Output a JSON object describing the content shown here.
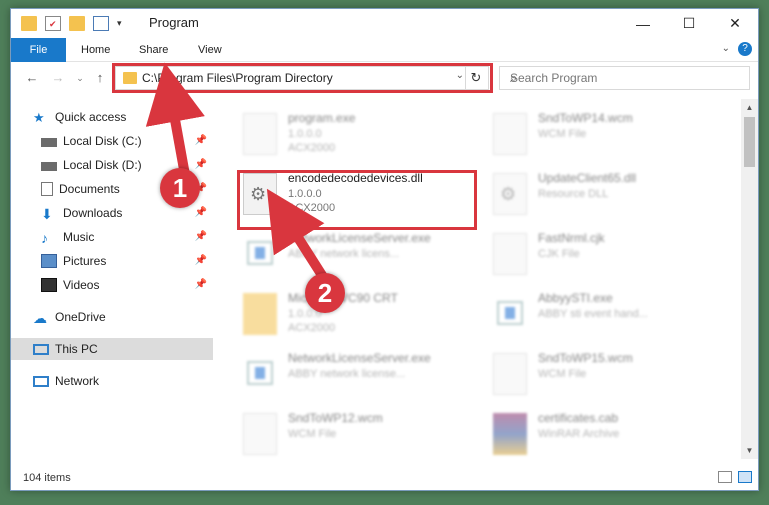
{
  "window": {
    "title": "Program"
  },
  "ribbon": {
    "tabs": [
      "File",
      "Home",
      "Share",
      "View"
    ]
  },
  "address": {
    "path": "C:\\Program Files\\Program Directory",
    "search_placeholder": "Search Program"
  },
  "nav": {
    "items": [
      {
        "label": "Quick access",
        "icon": "star-icon",
        "pinned": false
      },
      {
        "label": "Local Disk (C:)",
        "icon": "drive-icon",
        "pinned": true
      },
      {
        "label": "Local Disk (D:)",
        "icon": "drive-icon",
        "pinned": true
      },
      {
        "label": "Documents",
        "icon": "documents-icon",
        "pinned": true
      },
      {
        "label": "Downloads",
        "icon": "download-icon",
        "pinned": true
      },
      {
        "label": "Music",
        "icon": "music-icon",
        "pinned": true
      },
      {
        "label": "Pictures",
        "icon": "pictures-icon",
        "pinned": true
      },
      {
        "label": "Videos",
        "icon": "videos-icon",
        "pinned": true
      },
      {
        "label": "OneDrive",
        "icon": "cloud-icon",
        "pinned": false
      },
      {
        "label": "This PC",
        "icon": "computer-icon",
        "pinned": false,
        "selected": true
      },
      {
        "label": "Network",
        "icon": "network-icon",
        "pinned": false
      }
    ]
  },
  "files": {
    "left": [
      {
        "name": "program.exe",
        "line1": "1.0.0.0",
        "line2": "ACX2000"
      },
      {
        "name": "encodedecodedevices.dll",
        "line1": "1.0.0.0",
        "line2": "ACX2000"
      },
      {
        "name": "NetworkLicenseServer.exe",
        "line1": "ABBY network licens...",
        "line2": ""
      },
      {
        "name": "Microsoft VC90 CRT",
        "line1": "1.0.0.0",
        "line2": "ACX2000"
      },
      {
        "name": "NetworkLicenseServer.exe",
        "line1": "ABBY network license...",
        "line2": ""
      },
      {
        "name": "SndToWP12.wcm",
        "line1": "WCM File",
        "line2": ""
      }
    ],
    "right": [
      {
        "name": "SndToWP14.wcm",
        "line1": "WCM File",
        "line2": ""
      },
      {
        "name": "UpdateClient65.dll",
        "line1": "Resource DLL",
        "line2": ""
      },
      {
        "name": "FastNrml.cjk",
        "line1": "CJK File",
        "line2": ""
      },
      {
        "name": "AbbyySTI.exe",
        "line1": "ABBY sti event hand...",
        "line2": ""
      },
      {
        "name": "SndToWP15.wcm",
        "line1": "WCM File",
        "line2": ""
      },
      {
        "name": "certificates.cab",
        "line1": "WinRAR Archive",
        "line2": ""
      }
    ]
  },
  "status": {
    "count": "104 items"
  },
  "callouts": [
    "1",
    "2"
  ],
  "colors": {
    "accent": "#1979ca",
    "highlight": "#d9363e"
  }
}
